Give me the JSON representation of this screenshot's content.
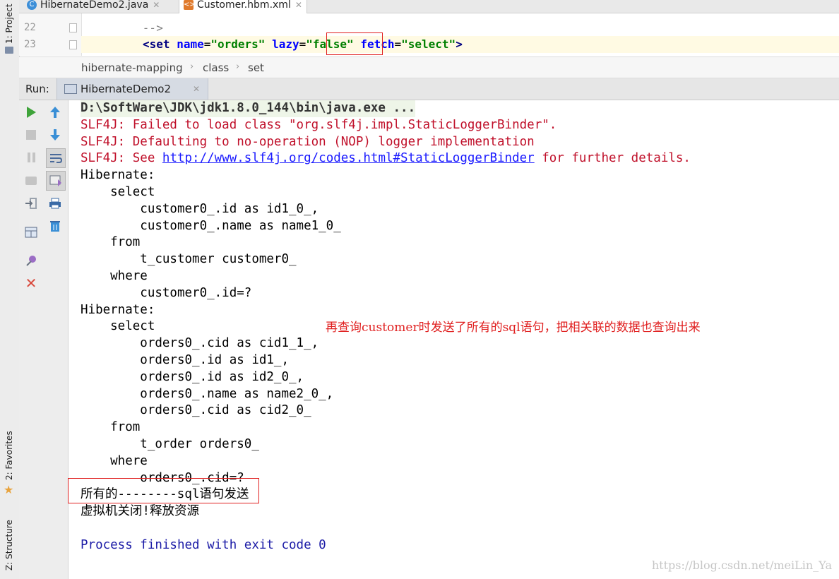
{
  "left_strip": {
    "project_label": "1: Project",
    "favorites_label": "2: Favorites",
    "structure_label": "Z: Structure"
  },
  "tabs": [
    {
      "label": "HibernateDemo2.java",
      "icon": "java-class-icon"
    },
    {
      "label": "Customer.hbm.xml",
      "icon": "xml-file-icon"
    }
  ],
  "editor": {
    "lines": [
      {
        "number": "22",
        "text": "-->"
      },
      {
        "number": "23",
        "tag_open": "<",
        "tag": "set",
        "attr1": "name",
        "val1": "\"orders\"",
        "attr2": "lazy",
        "val2": "\"false\"",
        "attr3": "fetch",
        "val3": "\"select\"",
        "tag_close": ">"
      }
    ]
  },
  "breadcrumb": [
    "hibernate-mapping",
    "class",
    "set"
  ],
  "run": {
    "label": "Run:",
    "tab_label": "HibernateDemo2"
  },
  "console": {
    "cmd": "D:\\SoftWare\\JDK\\jdk1.8.0_144\\bin\\java.exe ...",
    "err1": "SLF4J: Failed to load class \"org.slf4j.impl.StaticLoggerBinder\".",
    "err2": "SLF4J: Defaulting to no-operation (NOP) logger implementation",
    "err3_pre": "SLF4J: See ",
    "err3_link": "http://www.slf4j.org/codes.html#StaticLoggerBinder",
    "err3_post": " for further details.",
    "block1": [
      "Hibernate: ",
      "    select",
      "        customer0_.id as id1_0_,",
      "        customer0_.name as name1_0_ ",
      "    from",
      "        t_customer customer0_ ",
      "    where",
      "        customer0_.id=?"
    ],
    "block2": [
      "Hibernate: ",
      "    select",
      "        orders0_.cid as cid1_1_,",
      "        orders0_.id as id1_,",
      "        orders0_.id as id2_0_,",
      "        orders0_.name as name2_0_,",
      "        orders0_.cid as cid2_0_ ",
      "    from",
      "        t_order orders0_ ",
      "    where",
      "        orders0_.cid=?"
    ],
    "sent": "所有的--------sql语句发送",
    "shutdown": "虚拟机关闭!释放资源",
    "blank": "",
    "finished": "Process finished with exit code 0",
    "note": "再查询customer时发送了所有的sql语句，把相关联的数据也查询出来",
    "watermark": "https://blog.csdn.net/meiLin_Ya"
  },
  "colors": {
    "error_text": "#c0102a",
    "annotation_red": "#e02020",
    "link": "#1a1aff",
    "finished": "#1a1aa6"
  }
}
